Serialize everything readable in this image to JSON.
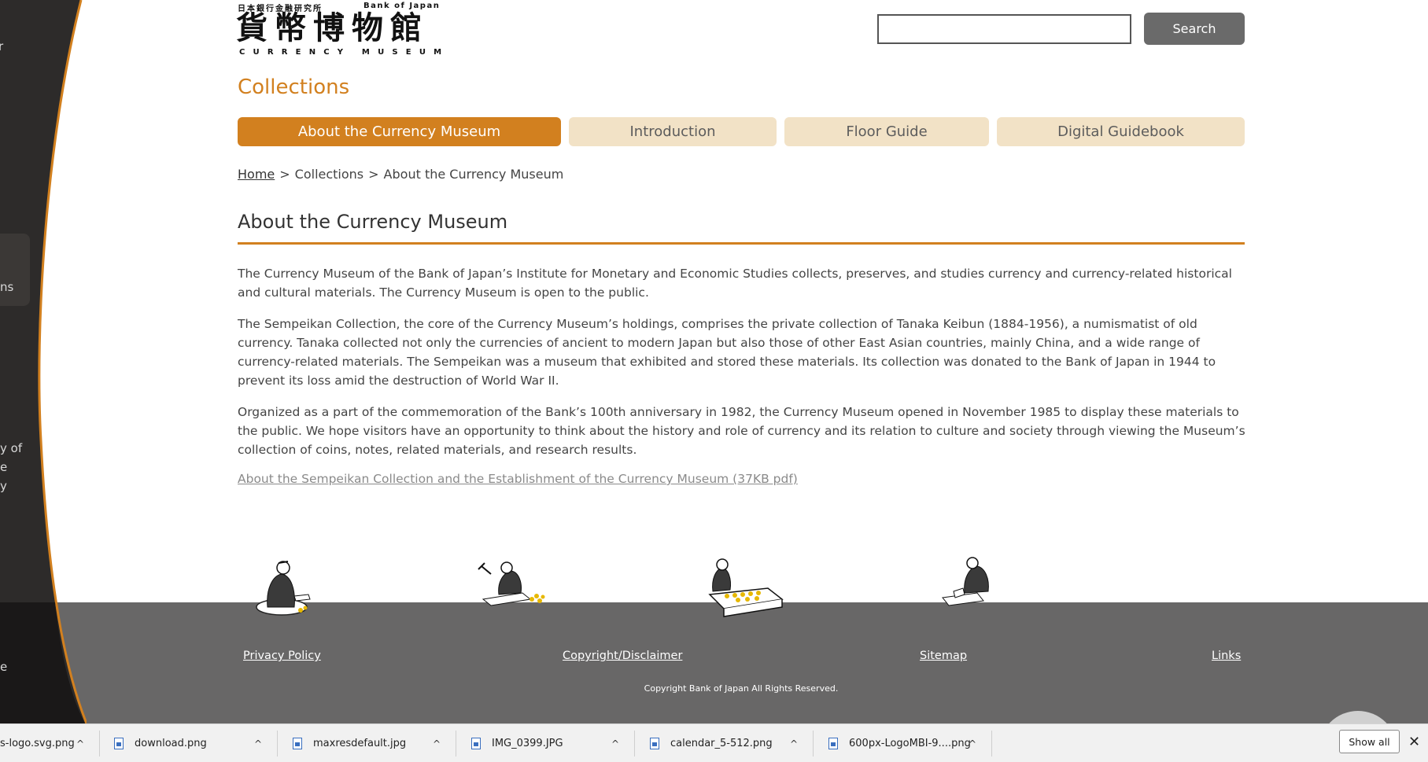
{
  "sidebar": {
    "fragments": [
      "r",
      "ns",
      "y of",
      "e",
      "y",
      "e"
    ]
  },
  "header": {
    "logo_top_jp": "日本銀行金融研究所",
    "logo_top_en": "Bank of Japan",
    "logo_main": "貨幣博物館",
    "logo_sub": "CURRENCY MUSEUM",
    "search_value": "",
    "search_button": "Search"
  },
  "section_title": "Collections",
  "tabs": [
    {
      "label": "About the Currency Museum",
      "active": true
    },
    {
      "label": "Introduction",
      "active": false
    },
    {
      "label": "Floor Guide",
      "active": false
    },
    {
      "label": "Digital Guidebook",
      "active": false
    }
  ],
  "breadcrumb": {
    "home": "Home",
    "separator": ">",
    "level1": "Collections",
    "current": "About the Currency Museum"
  },
  "main": {
    "heading": "About the Currency Museum",
    "paragraphs": [
      "The Currency Museum of the Bank of Japan’s Institute for Monetary and Economic Studies collects, preserves, and studies currency and currency-related historical and cultural materials. The Currency Museum is open to the public.",
      "The Sempeikan Collection, the core of the Currency Museum’s holdings, comprises the private collection of Tanaka Keibun (1884-1956), a numismatist of old currency. Tanaka collected not only the currencies of ancient to modern Japan but also those of other East Asian countries, mainly China, and a wide range of currency-related materials. The Sempeikan was a museum that exhibited and stored these materials. Its collection was donated to the Bank of Japan in 1944 to prevent its loss amid the destruction of World War II.",
      "Organized as a part of the commemoration of the Bank’s 100th anniversary in 1982, the Currency Museum opened in November 1985 to display these materials to the public. We hope visitors have an opportunity to think about the history and role of currency and its relation to culture and society through viewing the Museum’s collection of coins, notes, related materials, and research results."
    ],
    "pdf_link": "About the Sempeikan Collection and the Establishment of the Currency Museum (37KB pdf)"
  },
  "footer": {
    "links": [
      "Privacy Policy",
      "Copyright/Disclaimer",
      "Sitemap",
      "Links"
    ],
    "copyright": "Copyright Bank of Japan All Rights Reserved."
  },
  "downloads": {
    "items": [
      "s-logo.svg.png",
      "download.png",
      "maxresdefault.jpg",
      "IMG_0399.JPG",
      "calendar_5-512.png",
      "600px-LogoMBI-9....png"
    ],
    "show_all": "Show all",
    "close": "✕",
    "chevron": "^"
  },
  "colors": {
    "accent": "#d2801f",
    "tab_inactive": "#f2e2c6",
    "footer_bg": "#686767",
    "sidebar_bg": "#2d2b2a"
  }
}
